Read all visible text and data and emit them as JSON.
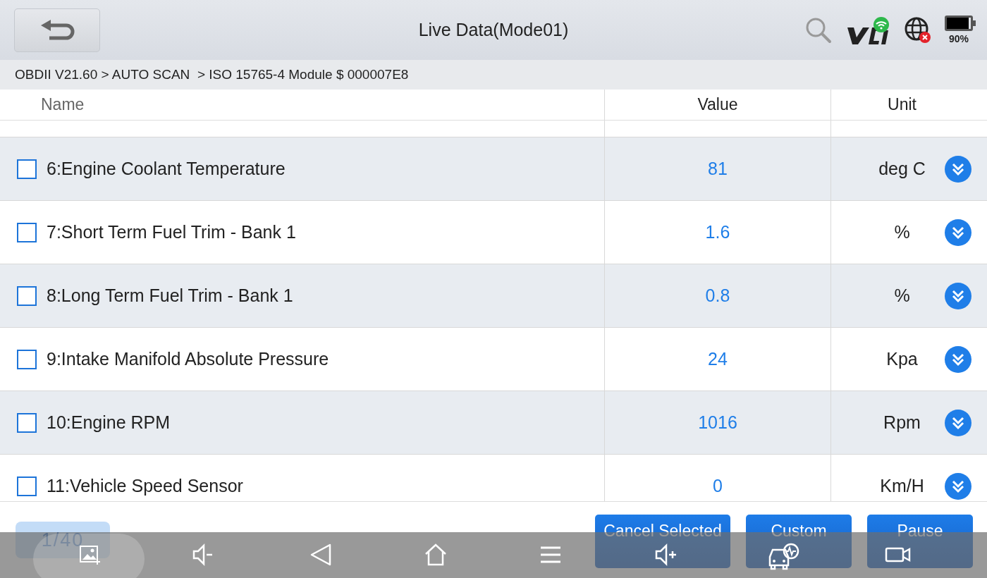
{
  "window": {
    "title": "Live Data(Mode01)"
  },
  "status": {
    "battery_text": "90%",
    "vci_connected": true,
    "network_connected": false
  },
  "breadcrumb": "OBDII V21.60 > AUTO SCAN  > ISO 15765-4 Module $ 000007E8",
  "columns": [
    "Name",
    "Value",
    "Unit"
  ],
  "rows": [
    {
      "name": "6:Engine Coolant Temperature",
      "value": "81",
      "unit": "deg C",
      "checked": false
    },
    {
      "name": "7:Short Term Fuel Trim - Bank 1",
      "value": "1.6",
      "unit": "%",
      "checked": false
    },
    {
      "name": "8:Long Term Fuel Trim - Bank 1",
      "value": "0.8",
      "unit": "%",
      "checked": false
    },
    {
      "name": "9:Intake Manifold Absolute Pressure",
      "value": "24",
      "unit": "Kpa",
      "checked": false
    },
    {
      "name": "10:Engine RPM",
      "value": "1016",
      "unit": "Rpm",
      "checked": false
    },
    {
      "name": "11:Vehicle Speed Sensor",
      "value": "0",
      "unit": "Km/H",
      "checked": false
    }
  ],
  "page_indicator": "1/40",
  "buttons": [
    "Cancel Selected",
    "Custom",
    "Pause"
  ]
}
